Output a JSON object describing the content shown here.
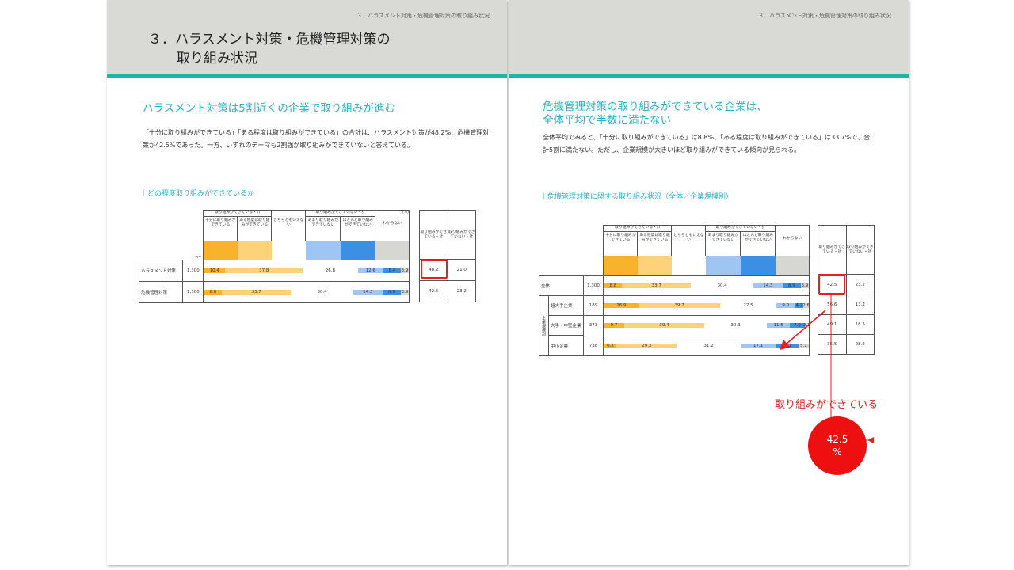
{
  "left_page": {
    "running_head": "３．ハラスメント対策・危機管理対策の取り組み状況",
    "chapter_title_line1": "３．ハラスメント対策・危機管理対策の",
    "chapter_title_line2": "取り組み状況",
    "heading": "ハラスメント対策は5割近くの企業で取り組みが進む",
    "body": "「十分に取り組みができている」「ある程度は取り組みができている」の合計は、ハラスメント対策が48.2%、危機管理対策が42.5%であった。一方、いずれのテーマも2割強が取り組みができていないと答えている。",
    "chart_caption": "｜どの程度取り組みができているか",
    "chart": {
      "group_yes": "取り組みができている・計",
      "group_no": "取り組みができていない・計",
      "unit": "(%)",
      "n_label": "n=",
      "cols": [
        "十分に取り組みができている",
        "ある程度は取り組みができている",
        "どちらともいえない",
        "あまり取り組みができていない",
        "ほとんど取り組みができていない",
        "わからない"
      ],
      "sum_cols": [
        "取り組みができている・計",
        "取り組みができていない・計"
      ],
      "rows": [
        {
          "label": "ハラスメント対策",
          "n": "1,300",
          "values": [
            "10.4",
            "37.8",
            "26.8",
            "12.6",
            "8.4",
            "3.9"
          ],
          "sum_yes": "48.2",
          "sum_no": "21.0"
        },
        {
          "label": "危機管理対策",
          "n": "1,300",
          "values": [
            "8.8",
            "33.7",
            "30.4",
            "14.3",
            "8.9",
            "3.9"
          ],
          "sum_yes": "42.5",
          "sum_no": "23.2"
        }
      ]
    }
  },
  "right_page": {
    "running_head": "３．ハラスメント対策・危機管理対策の取り組み状況",
    "heading_line1": "危機管理対策の取り組みができている企業は、",
    "heading_line2": "全体平均で半数に満たない",
    "body": "全体平均でみると、「十分に取り組みができている」は8.8%、「ある程度は取り組みができている」は33.7%で、合計5割に満たない。ただし、企業規模が大きいほど取り組みができている傾向が見られる。",
    "chart_caption": "｜危機管理対策に関する取り組み状況（全体／企業規模別）",
    "chart": {
      "group_yes": "取り組みができている・計",
      "group_no": "取り組みができていない・計",
      "cols": [
        "十分に取り組みができている",
        "ある程度は取り組みができている",
        "どちらともいえない",
        "あまり取り組みができていない",
        "ほとんど取り組みができていない",
        "わからない"
      ],
      "sum_cols": [
        "取り組みができている・計",
        "取り組みができていない・計"
      ],
      "side_label": "企業規模別",
      "rows": [
        {
          "label": "全体",
          "n": "1,300",
          "values": [
            "8.8",
            "33.7",
            "30.4",
            "14.3",
            "8.9",
            "3.9"
          ],
          "sum_yes": "42.5",
          "sum_no": "23.2"
        },
        {
          "label": "超大手企業",
          "n": "189",
          "values": [
            "16.9",
            "39.7",
            "27.5",
            "9.0",
            "4.2",
            "2.6"
          ],
          "sum_yes": "56.6",
          "sum_no": "13.2"
        },
        {
          "label": "大手・中堅企業",
          "n": "373",
          "values": [
            "9.7",
            "39.4",
            "30.3",
            "11.5",
            "7.0",
            "2.1"
          ],
          "sum_yes": "49.1",
          "sum_no": "18.5"
        },
        {
          "label": "中小企業",
          "n": "738",
          "values": [
            "6.2",
            "29.3",
            "31.2",
            "17.1",
            "11.1",
            "5.1"
          ],
          "sum_yes": "35.5",
          "sum_no": "28.2"
        }
      ]
    },
    "callout_label": "取り組みができている",
    "callout_value": "42.5",
    "callout_unit": "%"
  },
  "colors": {
    "accent_teal": "#1eb4a7",
    "heading_cyan": "#2bb3c8",
    "highlight_red": "#e52220"
  }
}
